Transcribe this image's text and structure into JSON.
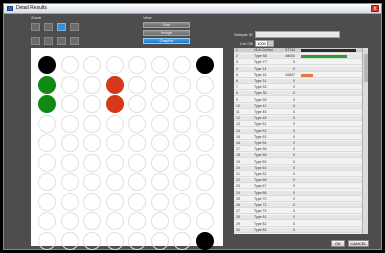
{
  "window": {
    "title": "Detail Results",
    "close_label": "x"
  },
  "zoom_label": "Zoom",
  "view_label": "View",
  "view_buttons": [
    "Grid",
    "Image",
    "Graphic"
  ],
  "view_active": 2,
  "sample_label": "Sample ID",
  "sample_value": "",
  "cutoff_label": "Cut Off",
  "cutoff_value": "1000",
  "table": {
    "headers": [
      "No.",
      "HLA Control",
      "57744"
    ],
    "rows": [
      {
        "no": "1",
        "name": "HLA Control",
        "value": "57744",
        "bar": "#2b2b2b",
        "fill": 0.95
      },
      {
        "no": "2",
        "name": "Type B8",
        "value": "48000",
        "bar": "#2f9c2f",
        "fill": 0.8
      },
      {
        "no": "3",
        "name": "Type Y7",
        "value": "0",
        "bar": "",
        "fill": 0
      },
      {
        "no": "4",
        "name": "Type 14",
        "value": "0",
        "bar": "",
        "fill": 0
      },
      {
        "no": "5",
        "name": "Type 16",
        "value": "10847",
        "bar": "#e07a4a",
        "fill": 0.2
      },
      {
        "no": "6",
        "name": "Type 31",
        "value": "0",
        "bar": "",
        "fill": 0
      },
      {
        "no": "7",
        "name": "Type 33",
        "value": "0",
        "bar": "",
        "fill": 0
      },
      {
        "no": "8",
        "name": "Type 35",
        "value": "0",
        "bar": "",
        "fill": 0
      },
      {
        "no": "9",
        "name": "Type 39",
        "value": "0",
        "bar": "",
        "fill": 0
      },
      {
        "no": "10",
        "name": "Type 42",
        "value": "0",
        "bar": "",
        "fill": 0
      },
      {
        "no": "11",
        "name": "Type 45",
        "value": "0",
        "bar": "",
        "fill": 0
      },
      {
        "no": "12",
        "name": "Type 48",
        "value": "0",
        "bar": "",
        "fill": 0
      },
      {
        "no": "13",
        "name": "Type 51",
        "value": "0",
        "bar": "",
        "fill": 0
      },
      {
        "no": "14",
        "name": "Type 52",
        "value": "0",
        "bar": "",
        "fill": 0
      },
      {
        "no": "15",
        "name": "Type 53",
        "value": "0",
        "bar": "",
        "fill": 0
      },
      {
        "no": "16",
        "name": "Type 54",
        "value": "0",
        "bar": "",
        "fill": 0
      },
      {
        "no": "17",
        "name": "Type 56",
        "value": "0",
        "bar": "",
        "fill": 0
      },
      {
        "no": "18",
        "name": "Type 58",
        "value": "0",
        "bar": "",
        "fill": 0
      },
      {
        "no": "19",
        "name": "Type 59",
        "value": "0",
        "bar": "",
        "fill": 0
      },
      {
        "no": "20",
        "name": "Type 61",
        "value": "0",
        "bar": "",
        "fill": 0
      },
      {
        "no": "21",
        "name": "Type 62",
        "value": "0",
        "bar": "",
        "fill": 0
      },
      {
        "no": "22",
        "name": "Type 66",
        "value": "0",
        "bar": "",
        "fill": 0
      },
      {
        "no": "23",
        "name": "Type 67",
        "value": "0",
        "bar": "",
        "fill": 0
      },
      {
        "no": "24",
        "name": "Type 68",
        "value": "0",
        "bar": "",
        "fill": 0
      },
      {
        "no": "25",
        "name": "Type 70",
        "value": "0",
        "bar": "",
        "fill": 0
      },
      {
        "no": "26",
        "name": "Type 72",
        "value": "0",
        "bar": "",
        "fill": 0
      },
      {
        "no": "27",
        "name": "Type 73",
        "value": "0",
        "bar": "",
        "fill": 0
      },
      {
        "no": "28",
        "name": "Type 81",
        "value": "0",
        "bar": "",
        "fill": 0
      },
      {
        "no": "29",
        "name": "Type 82",
        "value": "0",
        "bar": "",
        "fill": 0
      },
      {
        "no": "30",
        "name": "Type 83",
        "value": "0",
        "bar": "",
        "fill": 0
      }
    ]
  },
  "buttons": {
    "ok": "OK",
    "cancel": "CANCEL"
  }
}
